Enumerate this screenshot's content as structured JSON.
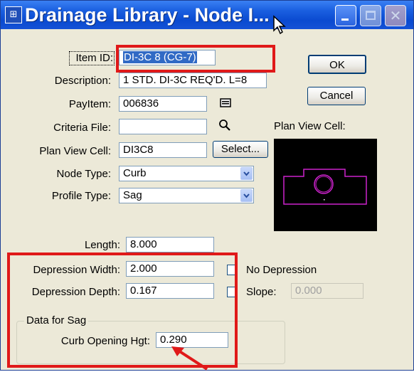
{
  "window": {
    "title": "Drainage Library - Node I...",
    "icon_name": "drainage-app-icon",
    "controls": [
      "minimize-icon",
      "maximize-icon",
      "close-icon"
    ]
  },
  "fields": {
    "item_id": {
      "label": "Item ID:",
      "value": "DI-3C 8 (CG-7)"
    },
    "description": {
      "label": "Description:",
      "value": "1 STD. DI-3C REQ'D. L=8"
    },
    "payitem": {
      "label": "PayItem:",
      "value": "006836"
    },
    "criteria_file": {
      "label": "Criteria File:",
      "value": ""
    },
    "plan_view_cell": {
      "label": "Plan View Cell:",
      "value": "DI3C8"
    },
    "node_type": {
      "label": "Node Type:",
      "value": "Curb"
    },
    "profile_type": {
      "label": "Profile Type:",
      "value": "Sag"
    },
    "length": {
      "label": "Length:",
      "value": "8.000"
    },
    "depression_width": {
      "label": "Depression Width:",
      "value": "2.000"
    },
    "depression_depth": {
      "label": "Depression Depth:",
      "value": "0.167"
    },
    "slope": {
      "label": "Slope:",
      "value": "0.000"
    },
    "curb_opening_hgt": {
      "label": "Curb Opening Hgt:",
      "value": "0.290"
    }
  },
  "checkboxes": {
    "no_depression": {
      "label": "No Depression",
      "checked": false
    },
    "slope": {
      "checked": false
    }
  },
  "buttons": {
    "ok": "OK",
    "cancel": "Cancel",
    "select": "Select..."
  },
  "preview": {
    "label": "Plan View Cell:",
    "line_color": "#cc22cc"
  },
  "group": {
    "sag_title": "Data for Sag"
  },
  "annotation": {
    "highlight_color": "#e01919"
  }
}
